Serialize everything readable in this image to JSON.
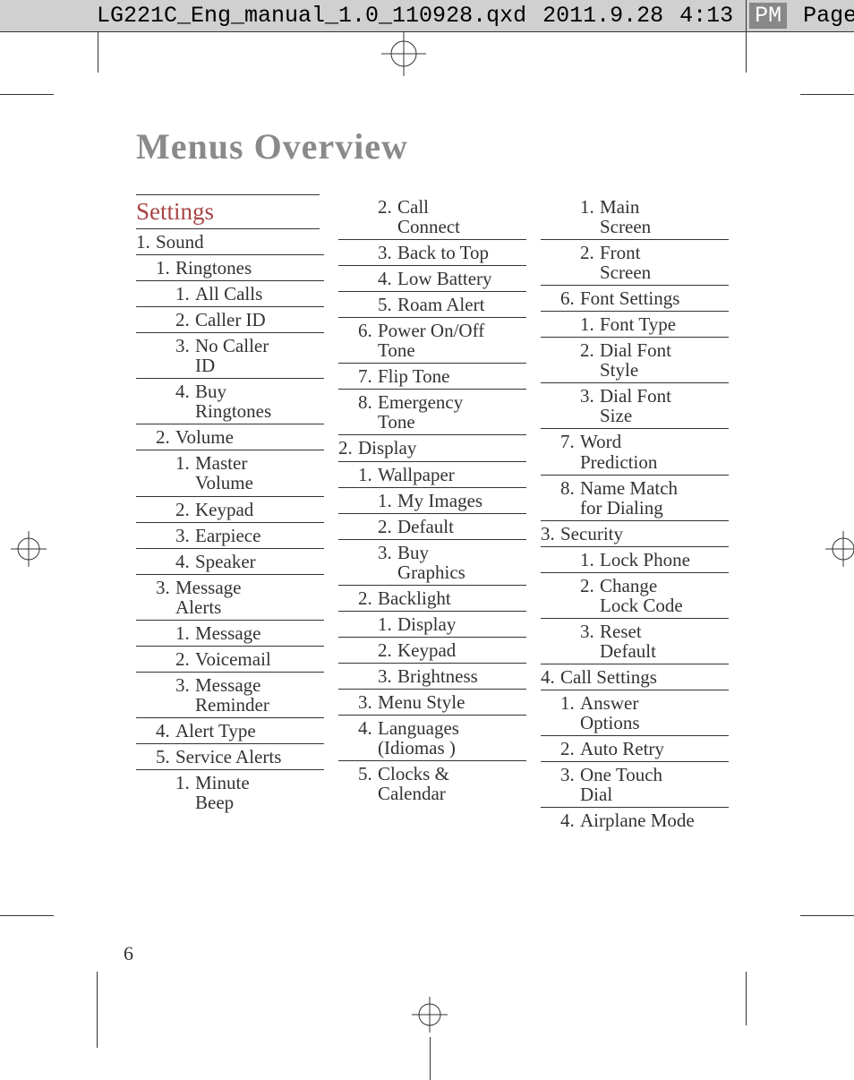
{
  "header": {
    "filename": "LG221C_Eng_manual_1.0_110928.qxd",
    "date": "2011.9.28",
    "time": "4:13",
    "meridiem": "PM",
    "page_label": "Page"
  },
  "title": "Menus Overview",
  "section_header": "Settings",
  "page_number": "6",
  "columns": [
    [
      {
        "lvl": 1,
        "num": "1.",
        "text": "Sound",
        "noTop": true
      },
      {
        "lvl": 2,
        "num": "1.",
        "text": "Ringtones"
      },
      {
        "lvl": 3,
        "num": "1.",
        "text": "All Calls"
      },
      {
        "lvl": 3,
        "num": "2.",
        "text": "Caller ID"
      },
      {
        "lvl": 3,
        "num": "3.",
        "text": "No Caller",
        "text2": "ID"
      },
      {
        "lvl": 3,
        "num": "4.",
        "text": "Buy",
        "text2": "Ringtones"
      },
      {
        "lvl": 2,
        "num": "2.",
        "text": "Volume"
      },
      {
        "lvl": 3,
        "num": "1.",
        "text": "Master",
        "text2": "Volume"
      },
      {
        "lvl": 3,
        "num": "2.",
        "text": "Keypad"
      },
      {
        "lvl": 3,
        "num": "3.",
        "text": "Earpiece"
      },
      {
        "lvl": 3,
        "num": "4.",
        "text": "Speaker"
      },
      {
        "lvl": 2,
        "num": "3.",
        "text": "Message",
        "text2": "Alerts"
      },
      {
        "lvl": 3,
        "num": "1.",
        "text": "Message"
      },
      {
        "lvl": 3,
        "num": "2.",
        "text": "Voicemail"
      },
      {
        "lvl": 3,
        "num": "3.",
        "text": "Message",
        "text2": "Reminder"
      },
      {
        "lvl": 2,
        "num": "4.",
        "text": "Alert Type"
      },
      {
        "lvl": 2,
        "num": "5.",
        "text": "Service Alerts"
      },
      {
        "lvl": 3,
        "num": "1.",
        "text": "Minute",
        "text2": "Beep"
      }
    ],
    [
      {
        "lvl": 3,
        "num": "2.",
        "text": "Call",
        "text2": "Connect",
        "noTop": true
      },
      {
        "lvl": 3,
        "num": "3.",
        "text": "Back to Top"
      },
      {
        "lvl": 3,
        "num": "4.",
        "text": "Low Battery"
      },
      {
        "lvl": 3,
        "num": "5.",
        "text": "Roam Alert"
      },
      {
        "lvl": 2,
        "num": "6.",
        "text": "Power On/Off",
        "text2": "Tone"
      },
      {
        "lvl": 2,
        "num": "7.",
        "text": "Flip Tone"
      },
      {
        "lvl": 2,
        "num": "8.",
        "text": "Emergency",
        "text2": "Tone"
      },
      {
        "lvl": 1,
        "num": "2.",
        "text": "Display"
      },
      {
        "lvl": 2,
        "num": "1.",
        "text": "Wallpaper"
      },
      {
        "lvl": 3,
        "num": "1.",
        "text": "My Images"
      },
      {
        "lvl": 3,
        "num": "2.",
        "text": "Default"
      },
      {
        "lvl": 3,
        "num": "3.",
        "text": "Buy",
        "text2": "Graphics"
      },
      {
        "lvl": 2,
        "num": "2.",
        "text": "Backlight"
      },
      {
        "lvl": 3,
        "num": "1.",
        "text": "Display"
      },
      {
        "lvl": 3,
        "num": "2.",
        "text": "Keypad"
      },
      {
        "lvl": 3,
        "num": "3.",
        "text": "Brightness"
      },
      {
        "lvl": 2,
        "num": "3.",
        "text": "Menu Style"
      },
      {
        "lvl": 2,
        "num": "4.",
        "text": "Languages",
        "text2": "(Idiomas )"
      },
      {
        "lvl": 2,
        "num": "5.",
        "text": "Clocks &",
        "text2": "Calendar"
      }
    ],
    [
      {
        "lvl": 3,
        "num": "1.",
        "text": "Main",
        "text2": "Screen",
        "noTop": true
      },
      {
        "lvl": 3,
        "num": "2.",
        "text": "Front",
        "text2": "Screen"
      },
      {
        "lvl": 2,
        "num": "6.",
        "text": "Font Settings"
      },
      {
        "lvl": 3,
        "num": "1.",
        "text": "Font Type"
      },
      {
        "lvl": 3,
        "num": "2.",
        "text": "Dial Font",
        "text2": "Style"
      },
      {
        "lvl": 3,
        "num": "3.",
        "text": "Dial Font",
        "text2": "Size"
      },
      {
        "lvl": 2,
        "num": "7.",
        "text": "Word",
        "text2": "Prediction"
      },
      {
        "lvl": 2,
        "num": "8.",
        "text": "Name Match",
        "text2": "for Dialing"
      },
      {
        "lvl": 1,
        "num": "3.",
        "text": "Security"
      },
      {
        "lvl": 3,
        "num": "1.",
        "text": "Lock Phone"
      },
      {
        "lvl": 3,
        "num": "2.",
        "text": "Change",
        "text2": "Lock Code"
      },
      {
        "lvl": 3,
        "num": "3.",
        "text": "Reset",
        "text2": "Default"
      },
      {
        "lvl": 1,
        "num": "4.",
        "text": "Call Settings"
      },
      {
        "lvl": 2,
        "num": "1.",
        "text": "Answer",
        "text2": "Options"
      },
      {
        "lvl": 2,
        "num": "2.",
        "text": "Auto Retry"
      },
      {
        "lvl": 2,
        "num": "3.",
        "text": "One Touch",
        "text2": "Dial"
      },
      {
        "lvl": 2,
        "num": "4.",
        "text": "Airplane Mode"
      }
    ]
  ]
}
